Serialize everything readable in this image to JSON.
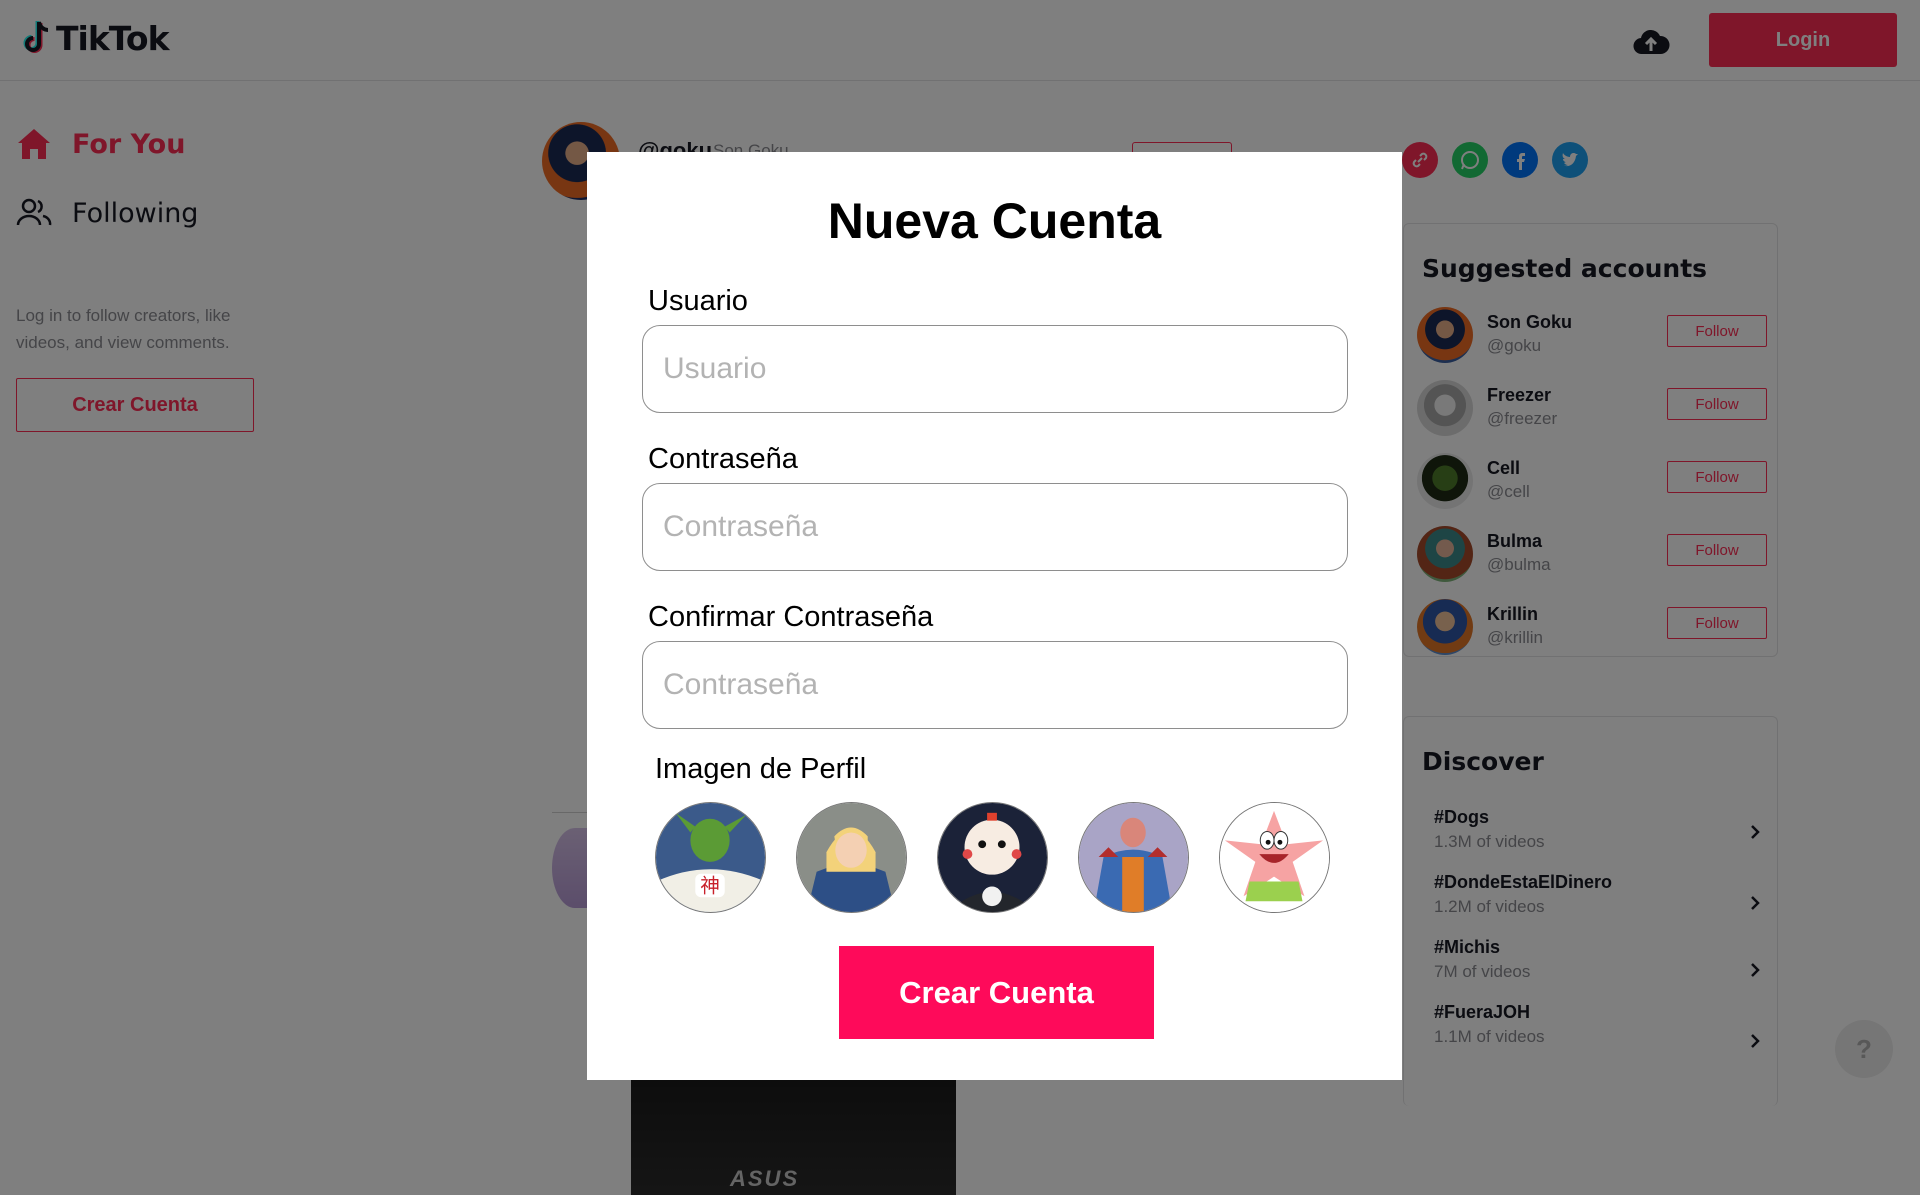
{
  "header": {
    "logo_text": "TikTok",
    "upload_icon": "cloud-upload-icon",
    "login_label": "Login",
    "accent_color": "#fe2c55"
  },
  "sidebar": {
    "nav": [
      {
        "label": "For You",
        "icon": "home-icon",
        "active": true
      },
      {
        "label": "Following",
        "icon": "users-icon",
        "active": false
      }
    ],
    "login_hint": "Log in to follow creators, like videos, and view comments.",
    "create_account_label": "Crear Cuenta"
  },
  "feed": {
    "post": {
      "username": "@goku",
      "display_name": "Son Goku"
    },
    "video_brand": "ASUS"
  },
  "share_icons": [
    "link-icon",
    "whatsapp-icon",
    "facebook-icon",
    "twitter-icon"
  ],
  "suggested": {
    "title": "Suggested accounts",
    "follow_label": "Follow",
    "accounts": [
      {
        "name": "Son Goku",
        "handle": "@goku"
      },
      {
        "name": "Freezer",
        "handle": "@freezer"
      },
      {
        "name": "Cell",
        "handle": "@cell"
      },
      {
        "name": "Bulma",
        "handle": "@bulma"
      },
      {
        "name": "Krillin",
        "handle": "@krillin"
      }
    ]
  },
  "discover": {
    "title": "Discover",
    "tags": [
      {
        "name": "#Dogs",
        "count": "1.3M of videos"
      },
      {
        "name": "#DondeEstaElDinero",
        "count": "1.2M of videos"
      },
      {
        "name": "#Michis",
        "count": "7M of videos"
      },
      {
        "name": "#FueraJOH",
        "count": "1.1M of videos"
      }
    ]
  },
  "help": {
    "label": "?"
  },
  "modal": {
    "title": "Nueva Cuenta",
    "username": {
      "label": "Usuario",
      "placeholder": "Usuario",
      "value": ""
    },
    "password": {
      "label": "Contraseña",
      "placeholder": "Contraseña",
      "value": ""
    },
    "confirm": {
      "label": "Confirmar Contraseña",
      "placeholder": "Contraseña",
      "value": ""
    },
    "image_label": "Imagen de Perfil",
    "avatars": [
      "kami-avatar",
      "android-18-avatar",
      "chiaotzu-avatar",
      "dabura-avatar",
      "patrick-avatar"
    ],
    "submit_label": "Crear Cuenta",
    "submit_color": "#fe0a5a"
  }
}
